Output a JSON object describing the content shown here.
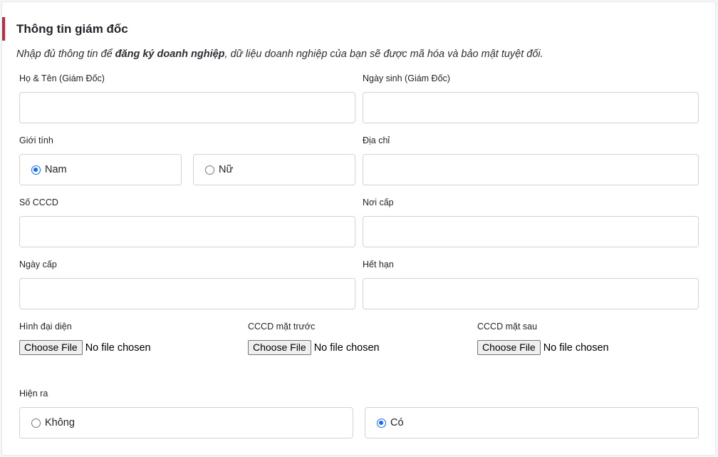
{
  "section": {
    "title": "Thông tin giám đốc",
    "intro_before": "Nhập đủ thông tin để ",
    "intro_bold": "đăng ký doanh nghiệp",
    "intro_after": ", dữ liệu doanh nghiệp của bạn sẽ được mã hóa và bảo mật tuyệt đối."
  },
  "colors": {
    "accent_bar": "#c4283a",
    "radio_checked": "#0d6efd"
  },
  "fields": {
    "full_name": {
      "label": "Họ & Tên (Giám Đốc)",
      "value": ""
    },
    "birthdate": {
      "label": "Ngày sinh (Giám Đốc)",
      "value": ""
    },
    "gender": {
      "label": "Giới tính",
      "options": [
        "Nam",
        "Nữ"
      ],
      "selected": "Nam"
    },
    "address": {
      "label": "Địa chỉ",
      "value": ""
    },
    "id_number": {
      "label": "Số CCCD",
      "value": ""
    },
    "issued_place": {
      "label": "Nơi cấp",
      "value": ""
    },
    "issued_date": {
      "label": "Ngày cấp",
      "value": ""
    },
    "expiry": {
      "label": "Hết hạn",
      "value": ""
    },
    "avatar": {
      "label": "Hình đại diện",
      "button": "Choose File",
      "status": "No file chosen"
    },
    "id_front": {
      "label": "CCCD mặt trước",
      "button": "Choose File",
      "status": "No file chosen"
    },
    "id_back": {
      "label": "CCCD mặt sau",
      "button": "Choose File",
      "status": "No file chosen"
    },
    "visible": {
      "label": "Hiện ra",
      "options": [
        "Không",
        "Có"
      ],
      "selected": "Có"
    }
  }
}
